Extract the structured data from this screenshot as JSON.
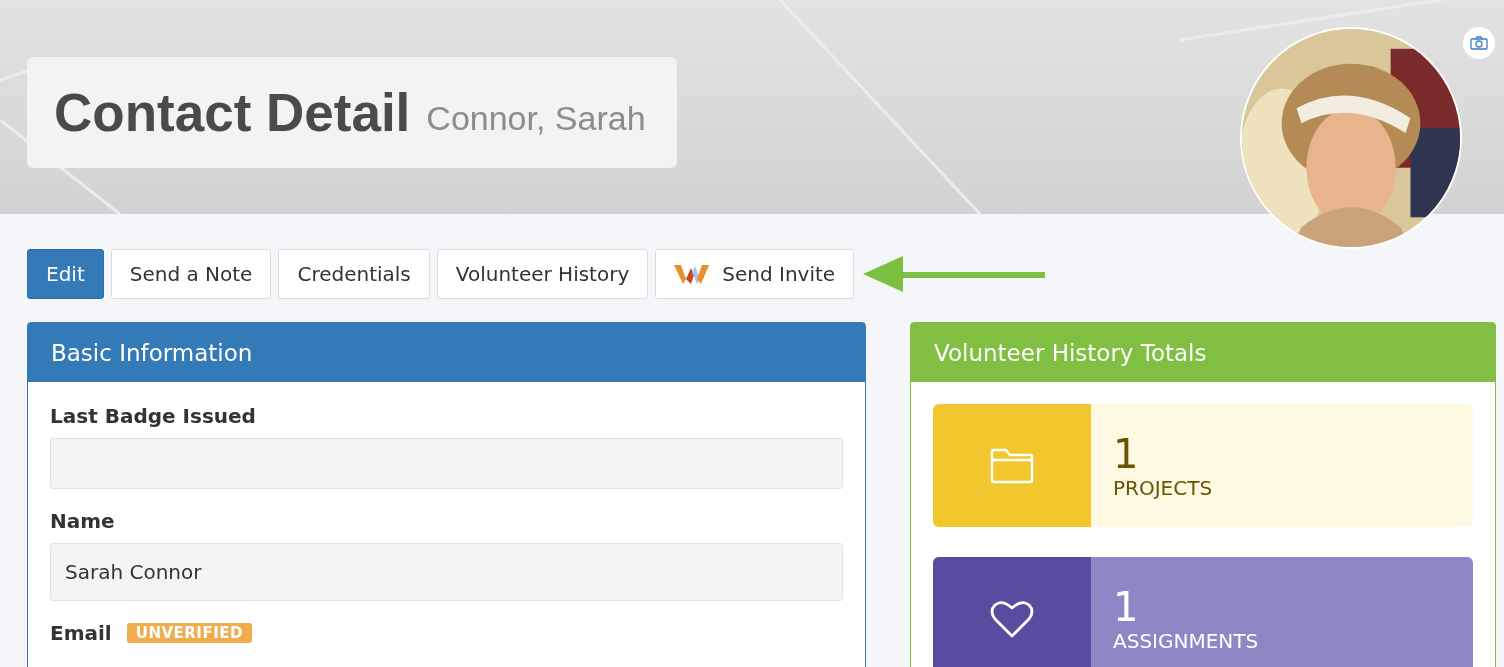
{
  "header": {
    "title": "Contact Detail",
    "subtitle": "Connor, Sarah"
  },
  "buttons": [
    {
      "label": "Edit",
      "kind": "primary"
    },
    {
      "label": "Send a Note",
      "kind": "default"
    },
    {
      "label": "Credentials",
      "kind": "default"
    },
    {
      "label": "Volunteer History",
      "kind": "default"
    },
    {
      "label": "Send Invite",
      "kind": "logo"
    }
  ],
  "basic_information": {
    "title": "Basic Information",
    "fields": [
      {
        "label": "Last Badge Issued"
      },
      {
        "label": "Name",
        "value": "Sarah Connor"
      },
      {
        "label": "Email",
        "badge": "UNVERIFIED"
      }
    ]
  },
  "volunteer_history_totals": {
    "title": "Volunteer History Totals",
    "stats": [
      {
        "kind": "folder",
        "count": "1",
        "label": "PROJECTS",
        "color": "#f2c72e"
      },
      {
        "kind": "heart",
        "count": "1",
        "label": "ASSIGNMENTS",
        "color": "#574c9f"
      }
    ]
  }
}
